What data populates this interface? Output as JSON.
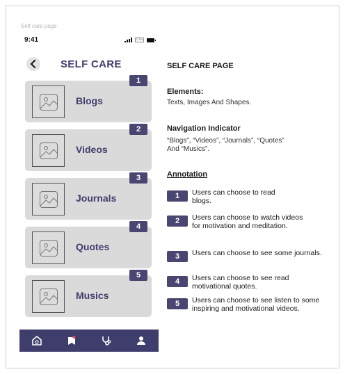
{
  "frame_label": "Self care page",
  "status_bar": {
    "time": "9:41",
    "network": "LTE"
  },
  "header": {
    "title": "SELF CARE"
  },
  "cards": [
    {
      "number": "1",
      "label": "Blogs"
    },
    {
      "number": "2",
      "label": "Videos"
    },
    {
      "number": "3",
      "label": "Journals"
    },
    {
      "number": "4",
      "label": "Quotes"
    },
    {
      "number": "5",
      "label": "Musics"
    }
  ],
  "bottom_nav": [
    "home-icon",
    "book-icon",
    "stethoscope-icon",
    "profile-icon"
  ],
  "colors": {
    "primary": "#3f3d6b",
    "badge": "#4a4672",
    "card": "#dadada"
  },
  "side": {
    "title": "SELF CARE PAGE",
    "elements_heading": "Elements:",
    "elements_text": "Texts, Images And Shapes.",
    "nav_heading": "Navigation Indicator",
    "nav_text": "“Blogs”, “Videos”, “Journals”, “Quotes” And “Musics”.",
    "annotation_heading": "Annotation",
    "annotations": [
      {
        "number": "1",
        "text": "Users can choose to read blogs."
      },
      {
        "number": "2",
        "text": "Users can choose to watch videos for motivation and meditation."
      },
      {
        "number": "3",
        "text": "Users can choose to see some journals."
      },
      {
        "number": "4",
        "text": "Users can choose to see read motivational quotes."
      },
      {
        "number": "5",
        "text": "Users can choose to see listen to some inspiring and motivational videos."
      }
    ]
  }
}
